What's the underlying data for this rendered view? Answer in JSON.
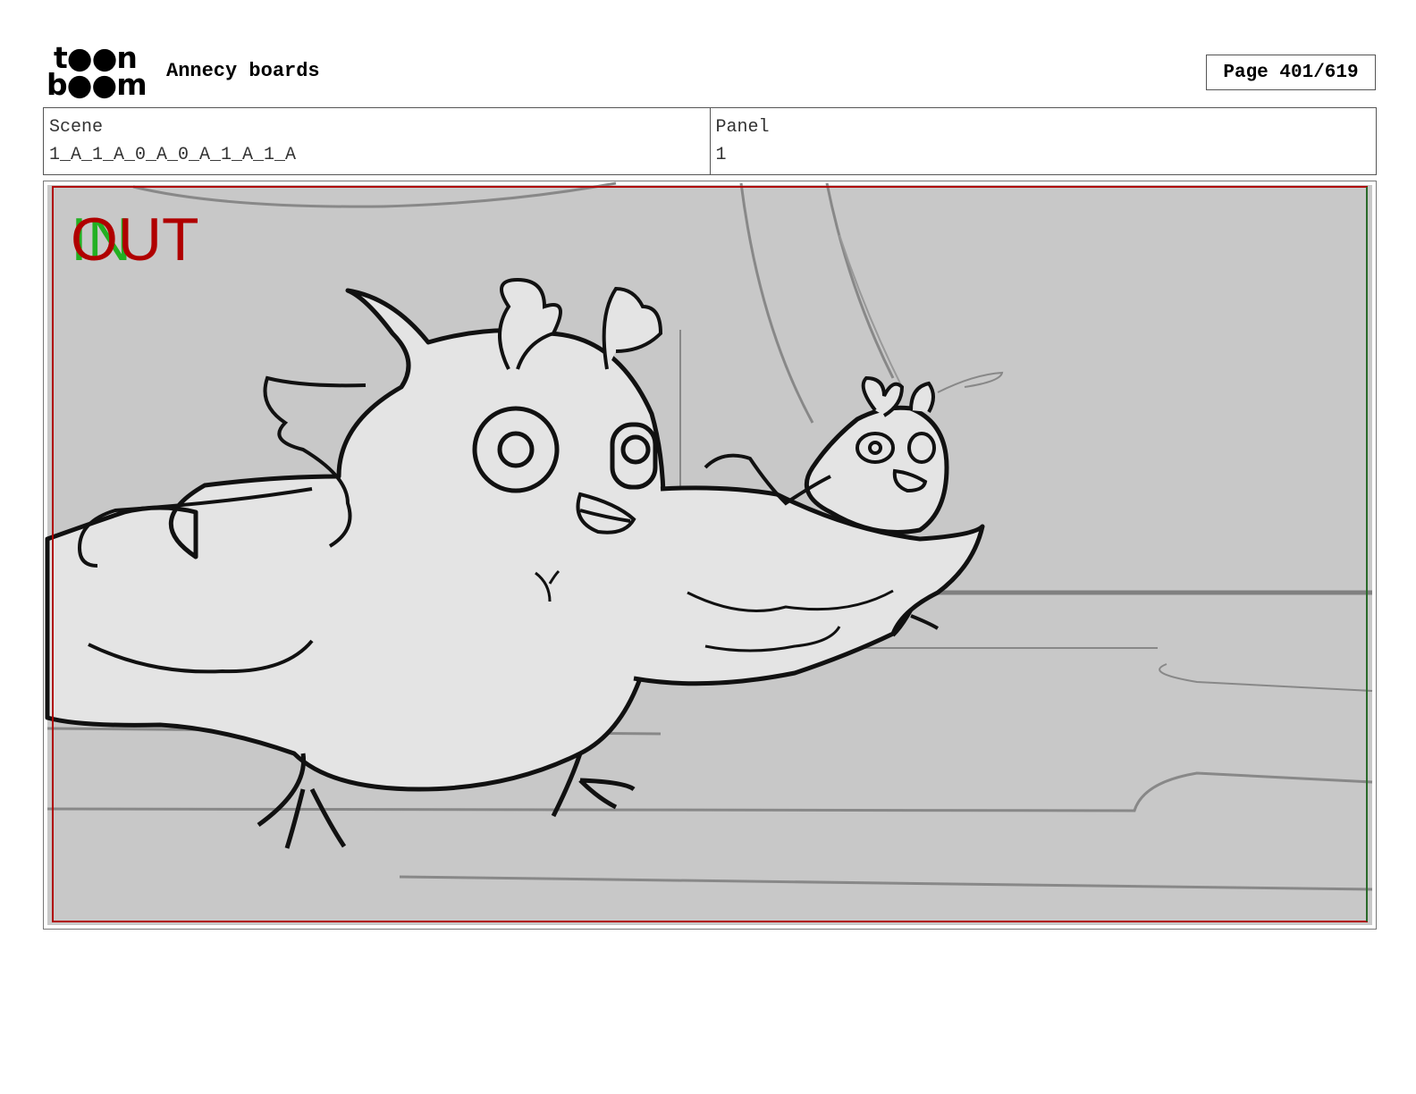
{
  "header": {
    "logo_top": "t●●n",
    "logo_bottom": "b●●m",
    "app_title": "Annecy boards",
    "page_counter": "Page 401/619"
  },
  "info": {
    "scene_label": "Scene",
    "scene_value": "1_A_1_A_0_A_0_A_1_A_1_A",
    "panel_label": "Panel",
    "panel_value": "1"
  },
  "frame": {
    "in_label": "IN",
    "out_label": "OUT",
    "border_color": "#b00000",
    "in_color": "#22b022",
    "out_color": "#b00000"
  }
}
